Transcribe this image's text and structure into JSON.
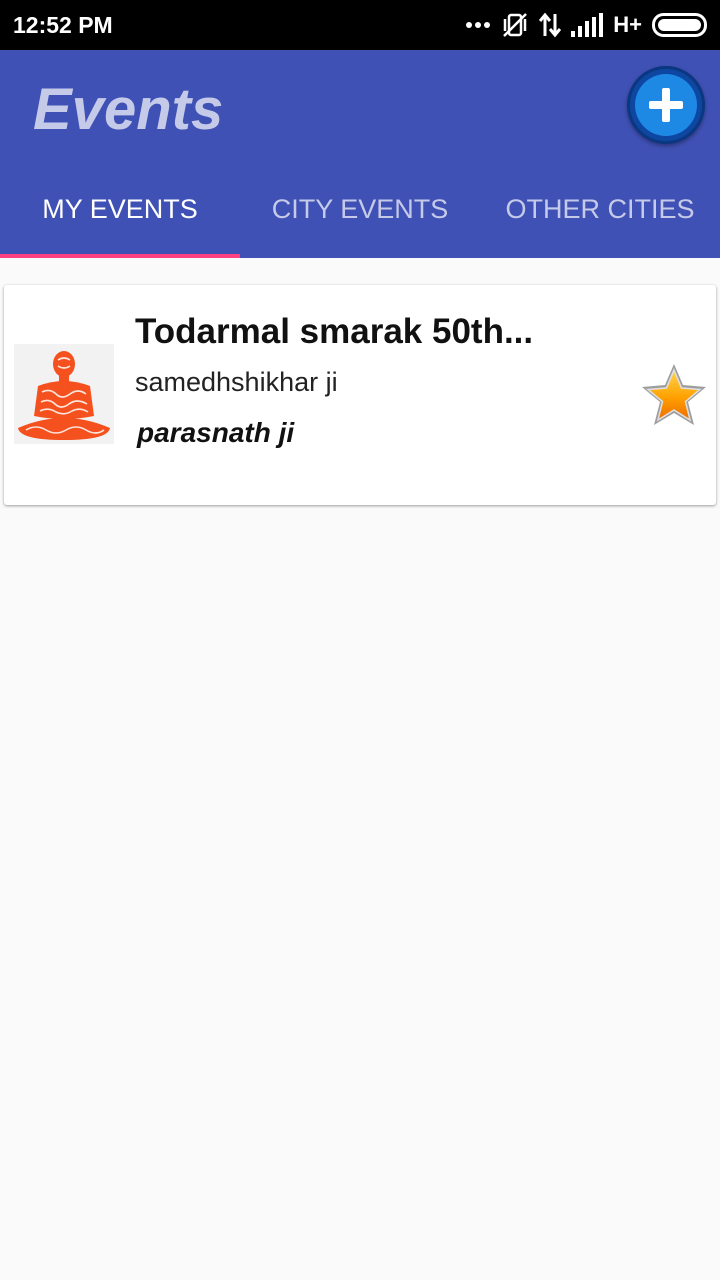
{
  "status_bar": {
    "time": "12:52 PM",
    "icons": [
      "more-dots-icon",
      "vibrate-icon",
      "data-transfer-icon",
      "signal-icon",
      "battery-icon"
    ],
    "network": "H+"
  },
  "app_bar": {
    "title": "Events",
    "add_button": "add-icon",
    "color": "#3f51b5"
  },
  "tabs": [
    {
      "label": "MY EVENTS",
      "active": true
    },
    {
      "label": "CITY EVENTS",
      "active": false
    },
    {
      "label": "OTHER CITIES",
      "active": false
    }
  ],
  "tab_indicator_color": "#ff4081",
  "events": [
    {
      "title": "Todarmal smarak 50th...",
      "venue": "samedhshikhar ji",
      "place": "parasnath ji",
      "thumbnail": "meditating-figure-icon",
      "favorite": "star-icon"
    }
  ]
}
